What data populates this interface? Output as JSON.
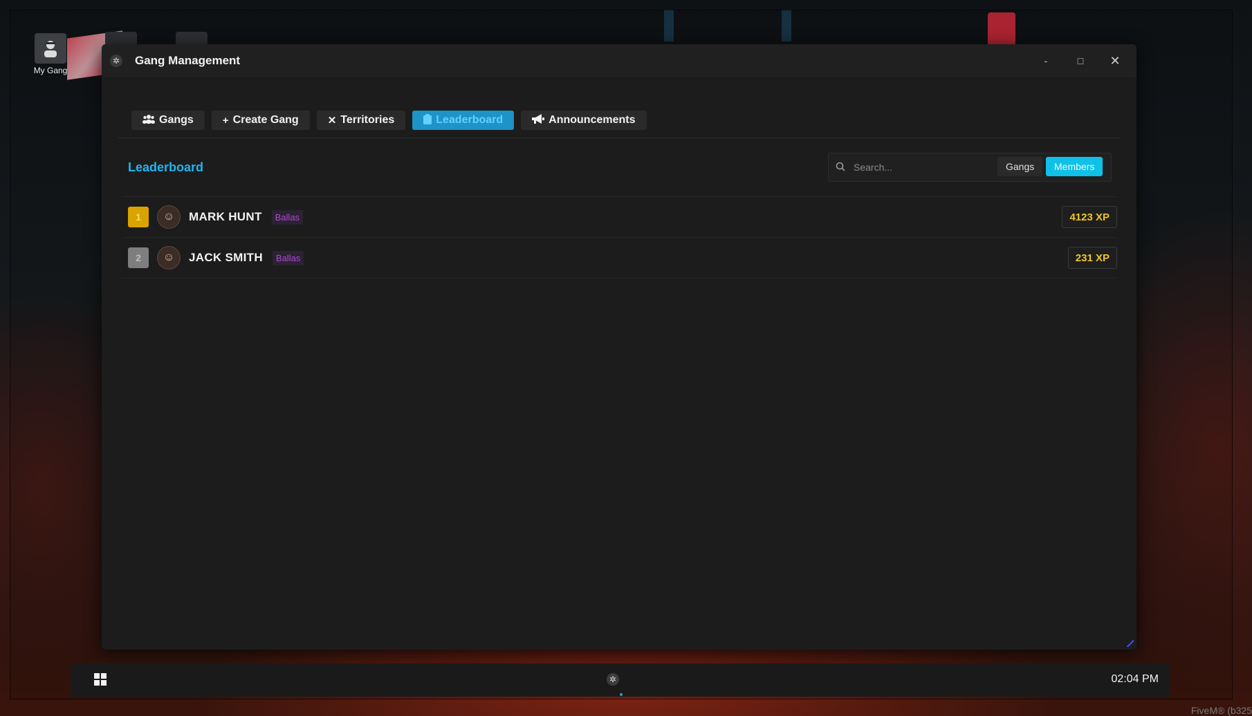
{
  "desktop": {
    "icon_label": "My Gang",
    "watermark": "FiveM® (b325"
  },
  "window": {
    "title": "Gang Management",
    "controls": {
      "minimize": "-",
      "maximize": "□",
      "close": "✕"
    }
  },
  "tabs": [
    {
      "label": "Gangs",
      "icon": "users-icon",
      "active": false
    },
    {
      "label": "Create Gang",
      "icon": "plus-icon",
      "active": false
    },
    {
      "label": "Territories",
      "icon": "crossed-swords-icon",
      "active": false
    },
    {
      "label": "Leaderboard",
      "icon": "clipboard-icon",
      "active": true
    },
    {
      "label": "Announcements",
      "icon": "megaphone-icon",
      "active": false
    }
  ],
  "leaderboard": {
    "title": "Leaderboard",
    "search": {
      "value": "",
      "placeholder": "Search..."
    },
    "filters": {
      "gangs": "Gangs",
      "members": "Members",
      "active": "Members"
    },
    "entries": [
      {
        "rank": "1",
        "name": "MARK HUNT",
        "gang": "Ballas",
        "xp": "4123 XP"
      },
      {
        "rank": "2",
        "name": "JACK SMITH",
        "gang": "Ballas",
        "xp": "231 XP"
      }
    ]
  },
  "taskbar": {
    "clock": "02:04 PM"
  },
  "colors": {
    "accent": "#1fb6f0",
    "active_tab_bg": "#1d93c7",
    "members_button": "#0fc1e8",
    "gold_rank": "#d9a300",
    "silver_rank": "#7e7e7e",
    "gang_badge": "#b246d9",
    "xp_text": "#f2c71f"
  }
}
